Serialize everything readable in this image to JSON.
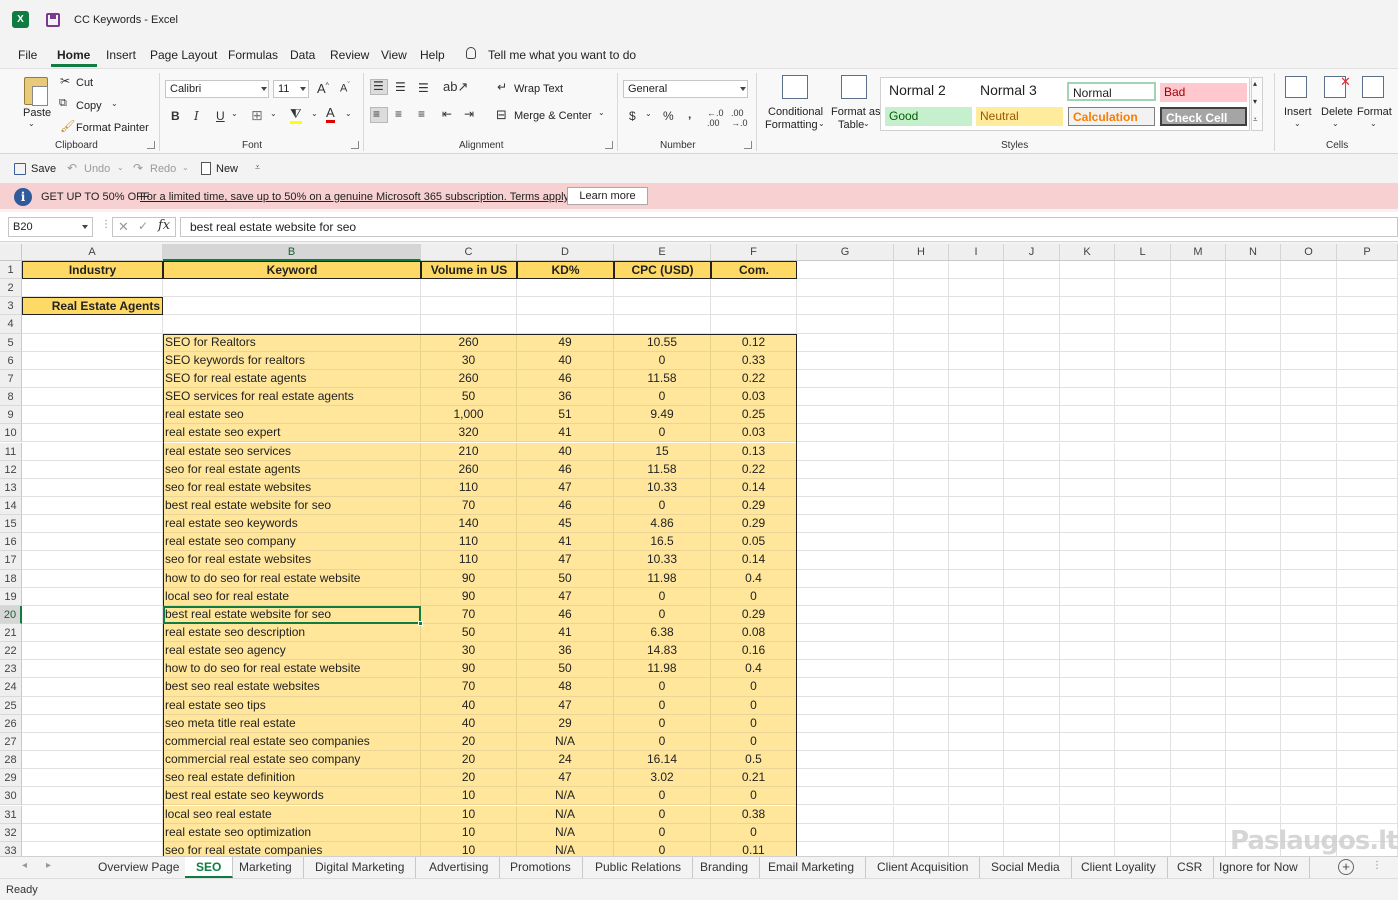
{
  "window": {
    "title": "CC Keywords  -  Excel",
    "app_icon": "excel-logo-icon"
  },
  "menu": {
    "items": [
      "File",
      "Home",
      "Insert",
      "Page Layout",
      "Formulas",
      "Data",
      "Review",
      "View",
      "Help"
    ],
    "active": "Home",
    "tell_me": "Tell me what you want to do"
  },
  "ribbon": {
    "clipboard": {
      "paste": "Paste",
      "cut": "Cut",
      "copy": "Copy",
      "format_painter": "Format Painter",
      "label": "Clipboard"
    },
    "font": {
      "name": "Calibri",
      "size": "11",
      "bold": "B",
      "italic": "I",
      "underline": "U",
      "label": "Font"
    },
    "alignment": {
      "wrap_text": "Wrap Text",
      "merge_center": "Merge & Center",
      "label": "Alignment"
    },
    "number": {
      "format": "General",
      "currency": "$",
      "percent": "%",
      "comma": "‚",
      "label": "Number"
    },
    "styles": {
      "conditional": "Conditional",
      "conditional2": "Formatting",
      "format_as": "Format as",
      "format_as2": "Table",
      "cells": [
        {
          "label": "Normal 2",
          "bg": "#ffffff",
          "color": "#222222"
        },
        {
          "label": "Normal 3",
          "bg": "#ffffff",
          "color": "#222222"
        },
        {
          "label": "Normal",
          "bg": "#ffffff",
          "color": "#222222"
        },
        {
          "label": "Bad",
          "bg": "#ffc7ce",
          "color": "#9c0006"
        },
        {
          "label": "Good",
          "bg": "#c6efce",
          "color": "#006100"
        },
        {
          "label": "Neutral",
          "bg": "#ffeb9c",
          "color": "#9c5700"
        },
        {
          "label": "Calculation",
          "bg": "#f2f2f2",
          "color": "#fa7d00"
        },
        {
          "label": "Check Cell",
          "bg": "#a5a5a5",
          "color": "#ffffff"
        }
      ],
      "label": "Styles"
    },
    "cells": {
      "insert": "Insert",
      "delete": "Delete",
      "format": "Format",
      "label": "Cells"
    }
  },
  "qat": {
    "save": "Save",
    "undo": "Undo",
    "redo": "Redo",
    "new": "New"
  },
  "message": {
    "bold": "GET UP TO 50% OFF",
    "link": "For a limited time, save up to 50% on a genuine Microsoft 365 subscription. Terms apply.",
    "button": "Learn more"
  },
  "formula_bar": {
    "name_box": "B20",
    "fx": "fx",
    "value": "best real estate website for seo"
  },
  "sheet": {
    "columns": [
      "A",
      "B",
      "C",
      "D",
      "E",
      "F",
      "G",
      "H",
      "I",
      "J",
      "K",
      "L",
      "M",
      "N",
      "O",
      "P"
    ],
    "headers": [
      "Industry",
      "Keyword",
      "Volume in US",
      "KD%",
      "CPC (USD)",
      "Com."
    ],
    "section": "Real Estate Agents",
    "rows": [
      [
        "SEO for Realtors",
        "260",
        "49",
        "10.55",
        "0.12"
      ],
      [
        "SEO keywords for realtors",
        "30",
        "40",
        "0",
        "0.33"
      ],
      [
        "SEO for real estate agents",
        "260",
        "46",
        "11.58",
        "0.22"
      ],
      [
        "SEO services for real estate agents",
        "50",
        "36",
        "0",
        "0.03"
      ],
      [
        "real estate seo",
        "1,000",
        "51",
        "9.49",
        "0.25"
      ],
      [
        "real estate seo expert",
        "320",
        "41",
        "0",
        "0.03"
      ],
      [
        "real estate seo services",
        "210",
        "40",
        "15",
        "0.13"
      ],
      [
        "seo for real estate agents",
        "260",
        "46",
        "11.58",
        "0.22"
      ],
      [
        "seo for real estate websites",
        "110",
        "47",
        "10.33",
        "0.14"
      ],
      [
        "best real estate website for seo",
        "70",
        "46",
        "0",
        "0.29"
      ],
      [
        "real estate seo keywords",
        "140",
        "45",
        "4.86",
        "0.29"
      ],
      [
        "real estate seo company",
        "110",
        "41",
        "16.5",
        "0.05"
      ],
      [
        "seo for real estate websites",
        "110",
        "47",
        "10.33",
        "0.14"
      ],
      [
        "how to do seo for real estate website",
        "90",
        "50",
        "11.98",
        "0.4"
      ],
      [
        "local seo for real estate",
        "90",
        "47",
        "0",
        "0"
      ],
      [
        "best real estate website for seo",
        "70",
        "46",
        "0",
        "0.29"
      ],
      [
        "real estate seo description",
        "50",
        "41",
        "6.38",
        "0.08"
      ],
      [
        "real estate seo agency",
        "30",
        "36",
        "14.83",
        "0.16"
      ],
      [
        "how to do seo for real estate website",
        "90",
        "50",
        "11.98",
        "0.4"
      ],
      [
        "best seo real estate websites",
        "70",
        "48",
        "0",
        "0"
      ],
      [
        "real estate seo tips",
        "40",
        "47",
        "0",
        "0"
      ],
      [
        "seo meta title real estate",
        "40",
        "29",
        "0",
        "0"
      ],
      [
        "commercial real estate seo companies",
        "20",
        "N/A",
        "0",
        "0"
      ],
      [
        "commercial real estate seo company",
        "20",
        "24",
        "16.14",
        "0.5"
      ],
      [
        "seo real estate definition",
        "20",
        "47",
        "3.02",
        "0.21"
      ],
      [
        "best real estate seo keywords",
        "10",
        "N/A",
        "0",
        "0"
      ],
      [
        "local seo real estate",
        "10",
        "N/A",
        "0",
        "0.38"
      ],
      [
        "real estate seo optimization",
        "10",
        "N/A",
        "0",
        "0"
      ],
      [
        "seo for real estate companies",
        "10",
        "N/A",
        "0",
        "0.11"
      ]
    ]
  },
  "tabs": {
    "items": [
      "Overview Page",
      "SEO",
      "Marketing",
      "Digital Marketing",
      "Advertising",
      "Promotions",
      "Public Relations",
      "Branding",
      "Email Marketing",
      "Client Acquisition",
      "Social Media",
      "Client Loyality",
      "CSR",
      "Ignore for Now"
    ],
    "active": "SEO"
  },
  "status": {
    "text": "Ready"
  },
  "watermark": "Paslaugos.lt"
}
